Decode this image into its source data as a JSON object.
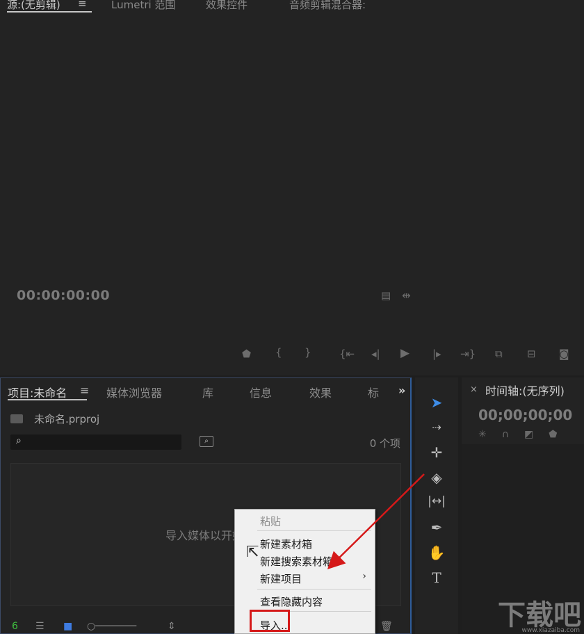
{
  "source_panel": {
    "tabs": [
      "源:(无剪辑)",
      "Lumetri 范围",
      "效果控件",
      "音频剪辑混合器:"
    ],
    "menu_glyph": "≡",
    "timecode": "00:00:00:00"
  },
  "project_panel": {
    "tabs": [
      "项目:未命名",
      "媒体浏览器",
      "库",
      "信息",
      "效果",
      "标"
    ],
    "menu_glyph": "≡",
    "more_glyph": "»",
    "file_name": "未命名.prproj",
    "item_count": "0 个项",
    "import_hint": "导入媒体以开始"
  },
  "timeline_panel": {
    "close_glyph": "×",
    "title": "时间轴:(无序列)",
    "timecode": "00;00;00;00"
  },
  "context_menu": {
    "items": [
      "粘贴",
      "新建素材箱",
      "新建搜索素材箱",
      "新建项目",
      "查看隐藏内容",
      "导入..."
    ],
    "submenu_glyph": "›"
  },
  "watermark": {
    "text": "下载吧",
    "sub": "www.xiazaiba.com"
  },
  "colors": {
    "accent_red": "#d51919",
    "panel_bg": "#232323",
    "menu_bg": "#f0f0f0",
    "focus_border": "#2f5d9b"
  },
  "icons": [
    "selection-tool-icon",
    "track-select-icon",
    "ripple-edit-icon",
    "razor-icon",
    "slip-icon",
    "pen-icon",
    "hand-icon",
    "type-icon"
  ]
}
